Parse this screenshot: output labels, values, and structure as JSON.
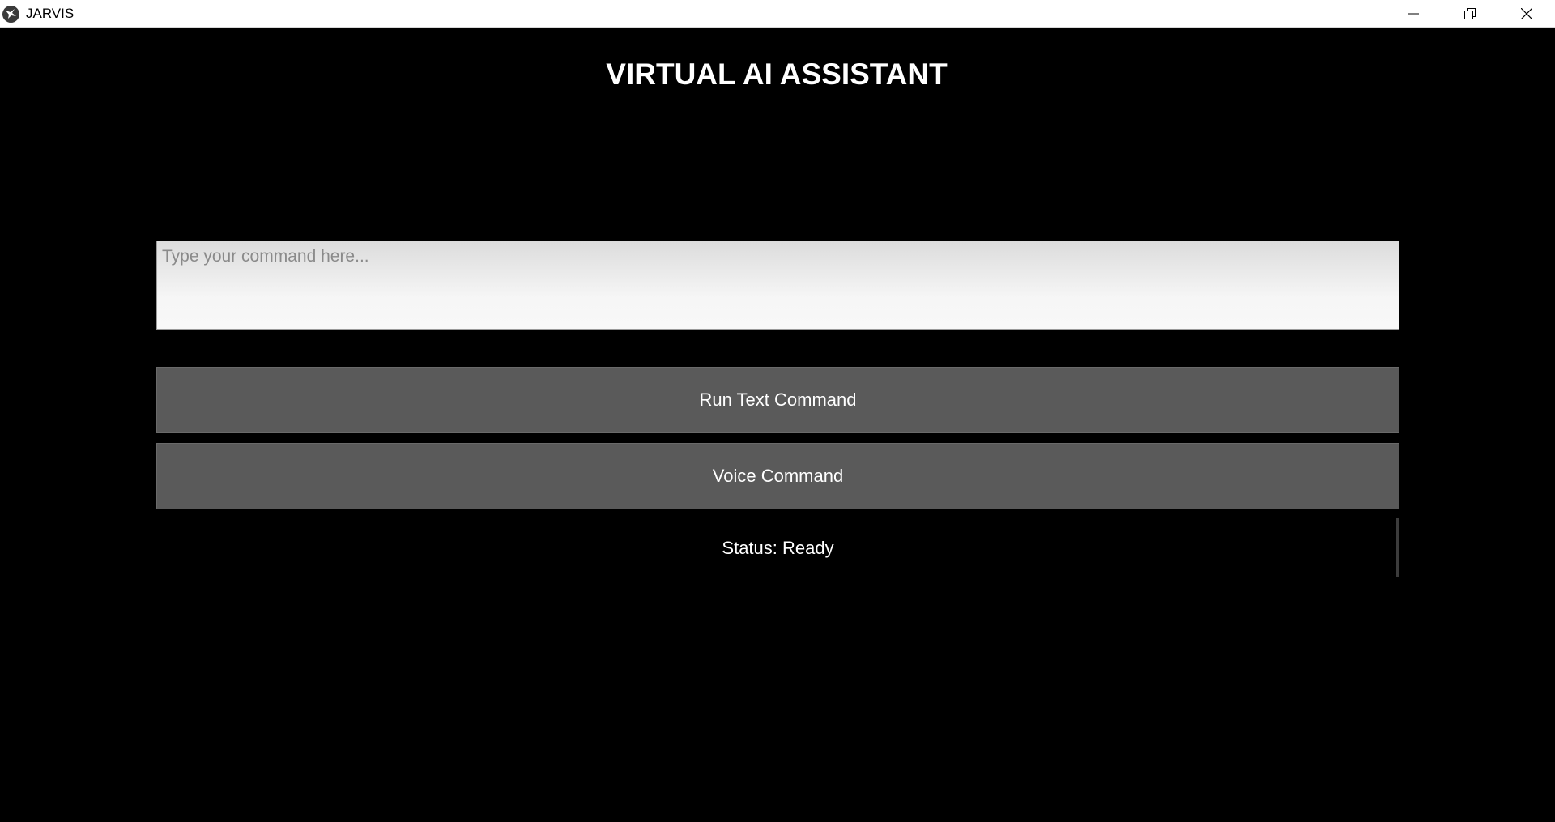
{
  "window": {
    "title": "JARVIS",
    "app_icon": "kivy-logo-icon",
    "controls": {
      "minimize": "minimize-icon",
      "maximize": "restore-icon",
      "close": "close-icon"
    }
  },
  "main": {
    "heading": "VIRTUAL AI ASSISTANT",
    "command_input": {
      "value": "",
      "placeholder": "Type your command here..."
    },
    "run_text_button": "Run Text Command",
    "voice_button": "Voice Command",
    "status": "Status: Ready"
  },
  "colors": {
    "background": "#000000",
    "button": "#5a5a5a",
    "text": "#ffffff",
    "titlebar": "#ffffff"
  }
}
